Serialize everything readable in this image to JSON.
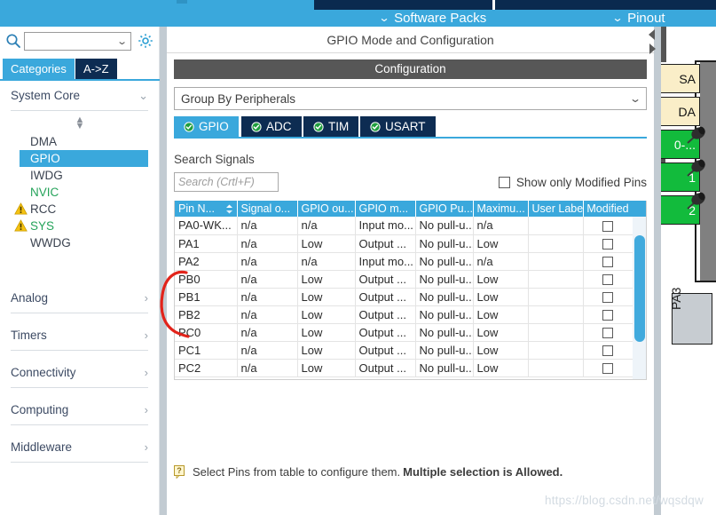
{
  "app": {
    "menus": [
      {
        "id": "software-packs",
        "label": "Software Packs",
        "icon": "chevron-down-icon"
      },
      {
        "id": "pinout",
        "label": "Pinout",
        "icon": "chevron-down-icon"
      }
    ]
  },
  "sidebar": {
    "search": {
      "value": "",
      "placeholder": "",
      "icon": "search-icon"
    },
    "settings_icon": "gear-icon",
    "tabs": [
      {
        "label": "Categories",
        "active": true
      },
      {
        "label": "A->Z",
        "active": false
      }
    ],
    "groups": [
      {
        "label": "System Core",
        "expanded": true,
        "items": [
          {
            "label": "DMA",
            "state": "normal",
            "warning": false
          },
          {
            "label": "GPIO",
            "state": "selected",
            "warning": false
          },
          {
            "label": "IWDG",
            "state": "normal",
            "warning": false
          },
          {
            "label": "NVIC",
            "state": "configured",
            "warning": false
          },
          {
            "label": "RCC",
            "state": "normal",
            "warning": true
          },
          {
            "label": "SYS",
            "state": "configured",
            "warning": true
          },
          {
            "label": "WWDG",
            "state": "normal",
            "warning": false
          }
        ]
      },
      {
        "label": "Analog",
        "expanded": false,
        "items": []
      },
      {
        "label": "Timers",
        "expanded": false,
        "items": []
      },
      {
        "label": "Connectivity",
        "expanded": false,
        "items": []
      },
      {
        "label": "Computing",
        "expanded": false,
        "items": []
      },
      {
        "label": "Middleware",
        "expanded": false,
        "items": []
      }
    ]
  },
  "main": {
    "title": "GPIO Mode and Configuration",
    "configuration_header": "Configuration",
    "group_by": {
      "value": "Group By Peripherals",
      "icon": "chevron-down-icon"
    },
    "peripheral_tabs": [
      {
        "label": "GPIO",
        "active": true,
        "status_icon": "check-circle-icon"
      },
      {
        "label": "ADC",
        "active": false,
        "status_icon": "check-circle-icon"
      },
      {
        "label": "TIM",
        "active": false,
        "status_icon": "check-circle-icon"
      },
      {
        "label": "USART",
        "active": false,
        "status_icon": "check-circle-icon"
      }
    ],
    "search_signals_label": "Search Signals",
    "search_signals": {
      "value": "",
      "placeholder": "Search (Crtl+F)"
    },
    "show_modified": {
      "label": "Show only Modified Pins",
      "checked": false
    },
    "table": {
      "columns": [
        {
          "label": "Pin N...",
          "sortable": true,
          "sort_icon": "sort-arrows-icon"
        },
        {
          "label": "Signal o...",
          "sortable": false
        },
        {
          "label": "GPIO ou...",
          "sortable": false
        },
        {
          "label": "GPIO m...",
          "sortable": false
        },
        {
          "label": "GPIO Pu...",
          "sortable": false
        },
        {
          "label": "Maximu...",
          "sortable": false
        },
        {
          "label": "User Label",
          "sortable": false
        },
        {
          "label": "Modified",
          "sortable": false
        }
      ],
      "rows": [
        {
          "pin": "PA0-WK...",
          "signal": "n/a",
          "output": "n/a",
          "mode": "Input mo...",
          "pull": "No pull-u...",
          "speed": "n/a",
          "user_label": "",
          "modified": false
        },
        {
          "pin": "PA1",
          "signal": "n/a",
          "output": "Low",
          "mode": "Output ...",
          "pull": "No pull-u...",
          "speed": "Low",
          "user_label": "",
          "modified": false
        },
        {
          "pin": "PA2",
          "signal": "n/a",
          "output": "n/a",
          "mode": "Input mo...",
          "pull": "No pull-u...",
          "speed": "n/a",
          "user_label": "",
          "modified": false
        },
        {
          "pin": "PB0",
          "signal": "n/a",
          "output": "Low",
          "mode": "Output ...",
          "pull": "No pull-u...",
          "speed": "Low",
          "user_label": "",
          "modified": false
        },
        {
          "pin": "PB1",
          "signal": "n/a",
          "output": "Low",
          "mode": "Output ...",
          "pull": "No pull-u...",
          "speed": "Low",
          "user_label": "",
          "modified": false
        },
        {
          "pin": "PB2",
          "signal": "n/a",
          "output": "Low",
          "mode": "Output ...",
          "pull": "No pull-u...",
          "speed": "Low",
          "user_label": "",
          "modified": false
        },
        {
          "pin": "PC0",
          "signal": "n/a",
          "output": "Low",
          "mode": "Output ...",
          "pull": "No pull-u...",
          "speed": "Low",
          "user_label": "",
          "modified": false
        },
        {
          "pin": "PC1",
          "signal": "n/a",
          "output": "Low",
          "mode": "Output ...",
          "pull": "No pull-u...",
          "speed": "Low",
          "user_label": "",
          "modified": false
        },
        {
          "pin": "PC2",
          "signal": "n/a",
          "output": "Low",
          "mode": "Output ...",
          "pull": "No pull-u...",
          "speed": "Low",
          "user_label": "",
          "modified": false
        }
      ]
    },
    "hint": {
      "icon": "help-icon",
      "text": "Select Pins from table to configure them. ",
      "emphasis": "Multiple selection is Allowed."
    }
  },
  "chip_view": {
    "pins": [
      {
        "label": "SA",
        "color": "cream"
      },
      {
        "label": "DA",
        "color": "cream"
      },
      {
        "label": "0-...",
        "color": "green"
      },
      {
        "label": "1",
        "color": "green"
      },
      {
        "label": "2",
        "color": "green"
      }
    ],
    "rotated_label": "PA3"
  },
  "watermark": "https://blog.csdn.net/wqsdqw",
  "colors": {
    "accent_blue": "#3aa8dc",
    "navy": "#0d2c52",
    "header_gray": "#575757",
    "green_pin": "#12bb3c",
    "cream_pin": "#faeec8",
    "warning_yellow": "#f5c211",
    "configured_green": "#25a35a",
    "annotation_red": "#e2231a"
  }
}
